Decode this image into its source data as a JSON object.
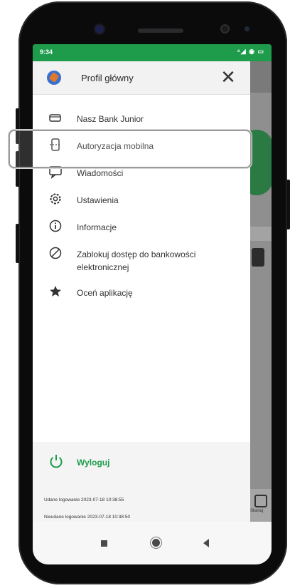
{
  "status_bar": {
    "time": "9:34",
    "icons": "⁴◢ ◉ ▭"
  },
  "drawer": {
    "profile_name": "Profil główny",
    "close_glyph": "✕",
    "items": [
      {
        "label": "Nasz Bank Junior",
        "icon": "card-icon"
      },
      {
        "label": "Autoryzacja mobilna",
        "icon": "mobile-auth-icon"
      },
      {
        "label": "Wiadomości",
        "icon": "message-icon"
      },
      {
        "label": "Ustawienia",
        "icon": "gear-icon"
      },
      {
        "label": "Informacje",
        "icon": "info-icon"
      },
      {
        "label": "Zablokuj dostęp do bankowości elektronicznej",
        "icon": "block-icon"
      },
      {
        "label": "Oceń aplikację",
        "icon": "star-icon"
      }
    ],
    "logout_label": "Wyloguj",
    "last_login_ok": "Udane logowanie 2023-07-18 10:38:55",
    "last_login_fail": "Nieudane logowanie 2023-07-18 10:38:50"
  },
  "background_app": {
    "bottom_label": "Skanuj"
  },
  "colors": {
    "accent": "#1e9c4c",
    "statusbar": "#1e9c4c"
  }
}
